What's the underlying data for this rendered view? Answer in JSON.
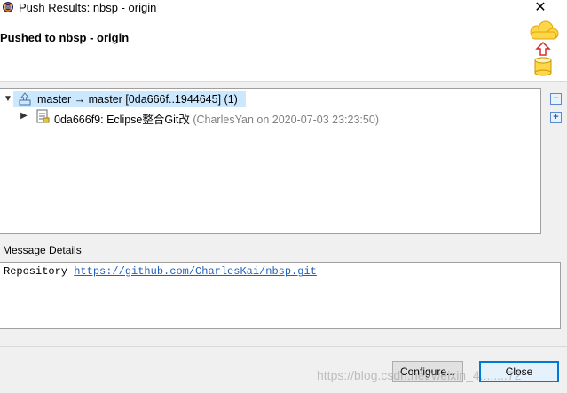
{
  "window": {
    "title": "Push Results: nbsp - origin",
    "close_glyph": "✕"
  },
  "header": {
    "heading": "Pushed to nbsp - origin"
  },
  "tree": {
    "rows": [
      {
        "twisty": "▼",
        "icon": "push-ref-icon",
        "text": "master → master [0da666f..1944645] (1)",
        "selected": true
      },
      {
        "twisty": "▶",
        "icon": "commit-icon",
        "text": "0da666f9: Eclipse整合Git改",
        "meta": "(CharlesYan on 2020-07-03 23:23:50)"
      }
    ],
    "collapse_all_glyph": "−",
    "expand_all_glyph": "+"
  },
  "message": {
    "label": "Message Details",
    "prefix": "Repository",
    "link": "https://github.com/CharlesKai/nbsp.git"
  },
  "buttons": {
    "configure": "Configure...",
    "close": "Close"
  },
  "watermark": "https://blog.csdn.net/weixin_4........72",
  "colors": {
    "selection": "#cce8ff",
    "link": "#1f5fbf",
    "accent": "#0078d7"
  }
}
